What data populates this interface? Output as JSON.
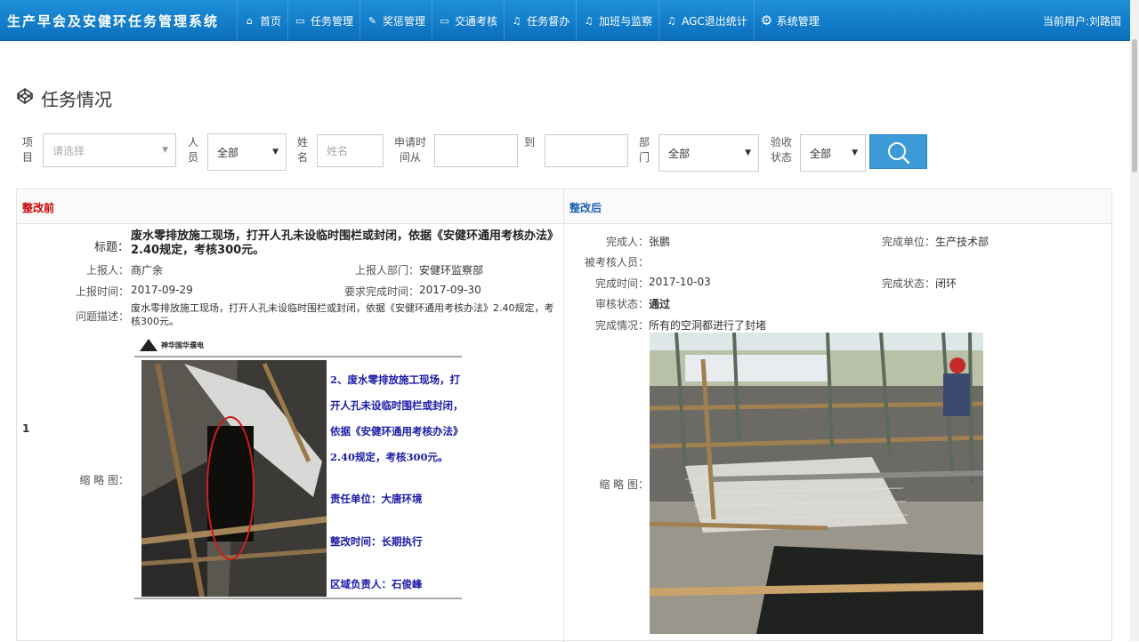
{
  "header": {
    "brand": "生产早会及安健环任务管理系统",
    "nav": [
      {
        "label": "首页",
        "icon": "home-icon",
        "glyph": "⌂"
      },
      {
        "label": "任务管理",
        "icon": "card-icon",
        "glyph": "▭"
      },
      {
        "label": "奖惩管理",
        "icon": "wrench-icon",
        "glyph": "✎"
      },
      {
        "label": "交通考核",
        "icon": "card-icon",
        "glyph": "▭"
      },
      {
        "label": "任务督办",
        "icon": "microphone-icon",
        "glyph": "♫"
      },
      {
        "label": "加班与监察",
        "icon": "microphone-icon",
        "glyph": "♫"
      },
      {
        "label": "AGC退出统计",
        "icon": "microphone-icon",
        "glyph": "♫"
      },
      {
        "label": "系统管理",
        "icon": "gear-icon",
        "glyph": "⚙"
      }
    ],
    "user": "当前用户:刘路国"
  },
  "page": {
    "title": "任务情况",
    "title_icon": "codepen-icon"
  },
  "filters": {
    "project_label": "项目",
    "project_placeholder": "请选择",
    "person_label": "人员",
    "person_value": "全部",
    "name_label": "姓名",
    "name_placeholder": "姓名",
    "date_from_label": "申请时间从",
    "date_from_value": "",
    "date_to_label": "到",
    "date_to_value": "",
    "dept_label": "部门",
    "dept_value": "全部",
    "status_label": "验收状态",
    "status_value": "全部",
    "search_icon": "search-icon"
  },
  "table": {
    "header_before": "整改前",
    "header_after": "整改后",
    "rows": [
      {
        "index": "1",
        "before": {
          "title_label": "标题：",
          "title": "废水零排放施工现场，打开人孔未设临时围栏或封闭，依据《安健环通用考核办法》2.40规定，考核300元。",
          "reporter_label": "上报人：",
          "reporter": "商广余",
          "reporter_dept_label": "上报人部门：",
          "reporter_dept": "安健环监察部",
          "report_time_label": "上报时间：",
          "report_time": "2017-09-29",
          "due_time_label": "要求完成时间：",
          "due_time": "2017-09-30",
          "desc_label": "问题描述：",
          "desc": "废水零排放施工现场，打开人孔未设临时围栏或封闭，依据《安健环通用考核办法》2.40规定，考核300元。",
          "thumb_label": "缩 略 图：",
          "thumb": {
            "logo_text": "神华国华濮电",
            "lines": [
              "2、废水零排放施工现场，打",
              "开人孔未设临时围栏或封闭，",
              "依据《安健环通用考核办法》",
              "2.40规定，考核300元。"
            ],
            "unit": "责任单位：大唐环境",
            "period": "整改时间：长期执行",
            "owner": "区域负责人：石俊峰"
          }
        },
        "after": {
          "finisher_label": "完成人：",
          "finisher": "张鹏",
          "finish_unit_label": "完成单位：",
          "finish_unit": "生产技术部",
          "assessed_label": "被考核人员：",
          "assessed": "",
          "finish_time_label": "完成时间：",
          "finish_time": "2017-10-03",
          "finish_status_label": "完成状态：",
          "finish_status": "闭环",
          "review_status_label": "审核状态：",
          "review_status": "通过",
          "finish_desc_label": "完成情况：",
          "finish_desc": "所有的空洞都进行了封堵",
          "thumb_label": "缩 略 图："
        }
      }
    ]
  },
  "colors": {
    "navbar": "#0b6fbd",
    "search_button": "#3c9ad8",
    "before_header": "#cc0000",
    "after_header": "#1a5fb4",
    "poster_text": "#1a1aa8"
  }
}
